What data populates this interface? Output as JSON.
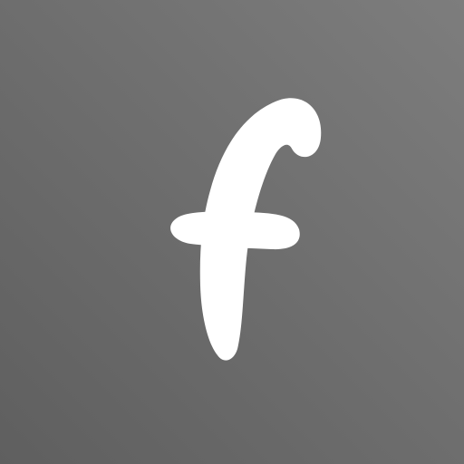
{
  "icon": {
    "name": "f-logo-icon",
    "background_colors": [
      "#5f5f5f",
      "#6c6c6c",
      "#7d7d7d"
    ],
    "glyph_color": "#ffffff"
  }
}
